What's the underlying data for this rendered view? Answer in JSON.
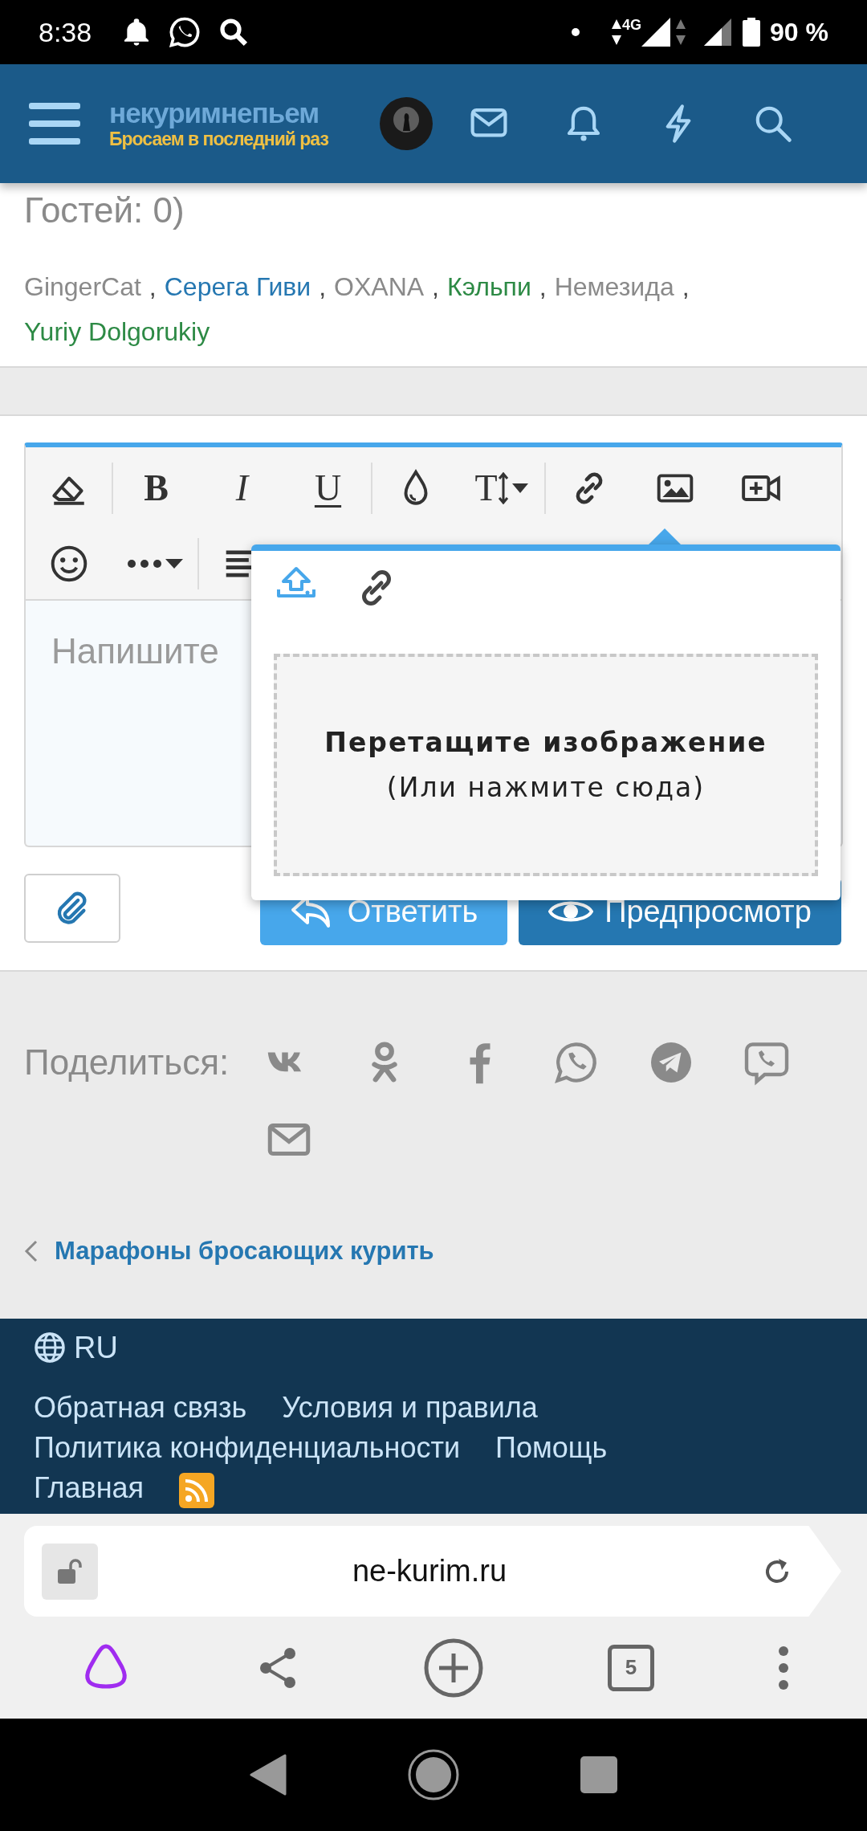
{
  "status_bar": {
    "time": "8:38",
    "network": "4G",
    "battery": "90 %"
  },
  "header": {
    "logo_top_left": "некурим",
    "logo_top_right": "непьем",
    "logo_tagline": "Бросаем в последний раз"
  },
  "online": {
    "guests": "Гостей: 0)",
    "users": [
      {
        "name": "GingerCat",
        "color": "#8a8a8a",
        "separator": ","
      },
      {
        "name": "Серега Гиви",
        "color": "#2577b1",
        "separator": ","
      },
      {
        "name": "OXANA",
        "color": "#8a8a8a",
        "separator": ","
      },
      {
        "name": "Кэльпи",
        "color": "#2d8a45",
        "separator": ","
      },
      {
        "name": "Немезида",
        "color": "#8a8a8a",
        "separator": ","
      },
      {
        "name": "Yuriy Dolgorukiy",
        "color": "#2d8a45"
      }
    ]
  },
  "editor": {
    "toolbar": [
      [
        [
          {
            "kind": "eraser"
          }
        ],
        [
          {
            "kind": "bold",
            "label": "B"
          },
          {
            "kind": "italic",
            "label": "I"
          },
          {
            "kind": "underline",
            "label": "U"
          }
        ],
        [
          {
            "kind": "drop"
          },
          {
            "kind": "size",
            "label": "T"
          }
        ],
        [
          {
            "kind": "link"
          },
          {
            "kind": "image"
          },
          {
            "kind": "video"
          }
        ]
      ],
      [
        [
          {
            "kind": "emoji"
          },
          {
            "kind": "more"
          }
        ],
        [
          {
            "kind": "align"
          }
        ]
      ]
    ],
    "placeholder": "Напишите",
    "reply_button": "Ответить",
    "preview_button": "Предпросмотр",
    "popup": {
      "tabs": [
        {
          "kind": "upload",
          "selected": true
        },
        {
          "kind": "link",
          "selected": false
        }
      ],
      "drop_title": "Перетащите изображение",
      "drop_hint": "(Или нажмите сюда)"
    }
  },
  "share": {
    "label": "Поделиться:",
    "services": [
      {
        "kind": "vk"
      },
      {
        "kind": "ok"
      },
      {
        "kind": "facebook"
      },
      {
        "kind": "whatsapp"
      },
      {
        "kind": "telegram"
      },
      {
        "kind": "viber"
      },
      {
        "kind": "email"
      }
    ]
  },
  "breadcrumb": "Марафоны бросающих курить",
  "footer": {
    "language": "RU",
    "links": [
      [
        "Обратная связь",
        "Условия и правила"
      ],
      [
        "Политика конфиденциальности",
        "Помощь"
      ],
      [
        "Главная"
      ]
    ]
  },
  "browser": {
    "url": "ne-kurim.ru",
    "tab_count": "5"
  }
}
